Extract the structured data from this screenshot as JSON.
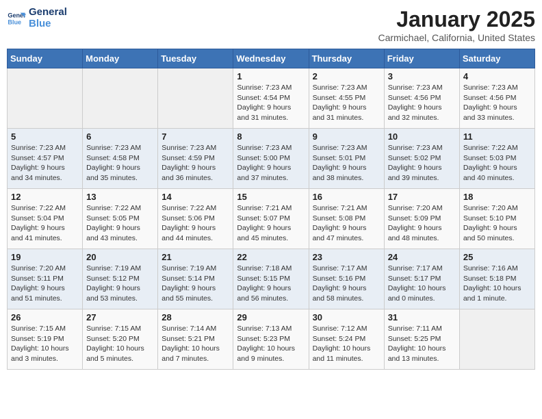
{
  "header": {
    "logo_line1": "General",
    "logo_line2": "Blue",
    "month": "January 2025",
    "location": "Carmichael, California, United States"
  },
  "weekdays": [
    "Sunday",
    "Monday",
    "Tuesday",
    "Wednesday",
    "Thursday",
    "Friday",
    "Saturday"
  ],
  "weeks": [
    [
      {
        "day": "",
        "info": ""
      },
      {
        "day": "",
        "info": ""
      },
      {
        "day": "",
        "info": ""
      },
      {
        "day": "1",
        "info": "Sunrise: 7:23 AM\nSunset: 4:54 PM\nDaylight: 9 hours\nand 31 minutes."
      },
      {
        "day": "2",
        "info": "Sunrise: 7:23 AM\nSunset: 4:55 PM\nDaylight: 9 hours\nand 31 minutes."
      },
      {
        "day": "3",
        "info": "Sunrise: 7:23 AM\nSunset: 4:56 PM\nDaylight: 9 hours\nand 32 minutes."
      },
      {
        "day": "4",
        "info": "Sunrise: 7:23 AM\nSunset: 4:56 PM\nDaylight: 9 hours\nand 33 minutes."
      }
    ],
    [
      {
        "day": "5",
        "info": "Sunrise: 7:23 AM\nSunset: 4:57 PM\nDaylight: 9 hours\nand 34 minutes."
      },
      {
        "day": "6",
        "info": "Sunrise: 7:23 AM\nSunset: 4:58 PM\nDaylight: 9 hours\nand 35 minutes."
      },
      {
        "day": "7",
        "info": "Sunrise: 7:23 AM\nSunset: 4:59 PM\nDaylight: 9 hours\nand 36 minutes."
      },
      {
        "day": "8",
        "info": "Sunrise: 7:23 AM\nSunset: 5:00 PM\nDaylight: 9 hours\nand 37 minutes."
      },
      {
        "day": "9",
        "info": "Sunrise: 7:23 AM\nSunset: 5:01 PM\nDaylight: 9 hours\nand 38 minutes."
      },
      {
        "day": "10",
        "info": "Sunrise: 7:23 AM\nSunset: 5:02 PM\nDaylight: 9 hours\nand 39 minutes."
      },
      {
        "day": "11",
        "info": "Sunrise: 7:22 AM\nSunset: 5:03 PM\nDaylight: 9 hours\nand 40 minutes."
      }
    ],
    [
      {
        "day": "12",
        "info": "Sunrise: 7:22 AM\nSunset: 5:04 PM\nDaylight: 9 hours\nand 41 minutes."
      },
      {
        "day": "13",
        "info": "Sunrise: 7:22 AM\nSunset: 5:05 PM\nDaylight: 9 hours\nand 43 minutes."
      },
      {
        "day": "14",
        "info": "Sunrise: 7:22 AM\nSunset: 5:06 PM\nDaylight: 9 hours\nand 44 minutes."
      },
      {
        "day": "15",
        "info": "Sunrise: 7:21 AM\nSunset: 5:07 PM\nDaylight: 9 hours\nand 45 minutes."
      },
      {
        "day": "16",
        "info": "Sunrise: 7:21 AM\nSunset: 5:08 PM\nDaylight: 9 hours\nand 47 minutes."
      },
      {
        "day": "17",
        "info": "Sunrise: 7:20 AM\nSunset: 5:09 PM\nDaylight: 9 hours\nand 48 minutes."
      },
      {
        "day": "18",
        "info": "Sunrise: 7:20 AM\nSunset: 5:10 PM\nDaylight: 9 hours\nand 50 minutes."
      }
    ],
    [
      {
        "day": "19",
        "info": "Sunrise: 7:20 AM\nSunset: 5:11 PM\nDaylight: 9 hours\nand 51 minutes."
      },
      {
        "day": "20",
        "info": "Sunrise: 7:19 AM\nSunset: 5:12 PM\nDaylight: 9 hours\nand 53 minutes."
      },
      {
        "day": "21",
        "info": "Sunrise: 7:19 AM\nSunset: 5:14 PM\nDaylight: 9 hours\nand 55 minutes."
      },
      {
        "day": "22",
        "info": "Sunrise: 7:18 AM\nSunset: 5:15 PM\nDaylight: 9 hours\nand 56 minutes."
      },
      {
        "day": "23",
        "info": "Sunrise: 7:17 AM\nSunset: 5:16 PM\nDaylight: 9 hours\nand 58 minutes."
      },
      {
        "day": "24",
        "info": "Sunrise: 7:17 AM\nSunset: 5:17 PM\nDaylight: 10 hours\nand 0 minutes."
      },
      {
        "day": "25",
        "info": "Sunrise: 7:16 AM\nSunset: 5:18 PM\nDaylight: 10 hours\nand 1 minute."
      }
    ],
    [
      {
        "day": "26",
        "info": "Sunrise: 7:15 AM\nSunset: 5:19 PM\nDaylight: 10 hours\nand 3 minutes."
      },
      {
        "day": "27",
        "info": "Sunrise: 7:15 AM\nSunset: 5:20 PM\nDaylight: 10 hours\nand 5 minutes."
      },
      {
        "day": "28",
        "info": "Sunrise: 7:14 AM\nSunset: 5:21 PM\nDaylight: 10 hours\nand 7 minutes."
      },
      {
        "day": "29",
        "info": "Sunrise: 7:13 AM\nSunset: 5:23 PM\nDaylight: 10 hours\nand 9 minutes."
      },
      {
        "day": "30",
        "info": "Sunrise: 7:12 AM\nSunset: 5:24 PM\nDaylight: 10 hours\nand 11 minutes."
      },
      {
        "day": "31",
        "info": "Sunrise: 7:11 AM\nSunset: 5:25 PM\nDaylight: 10 hours\nand 13 minutes."
      },
      {
        "day": "",
        "info": ""
      }
    ]
  ]
}
